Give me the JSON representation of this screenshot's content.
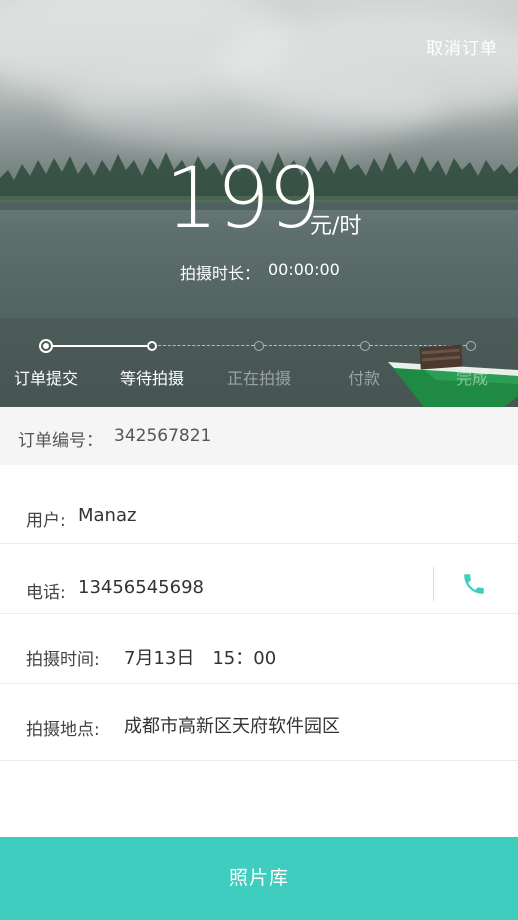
{
  "header": {
    "cancel_label": "取消订单",
    "price": "199",
    "price_unit": "元/时",
    "duration_label": "拍摄时长：",
    "duration_value": "00:00:00"
  },
  "steps": [
    {
      "label": "订单提交",
      "state": "done"
    },
    {
      "label": "等待拍摄",
      "state": "current"
    },
    {
      "label": "正在拍摄",
      "state": "pending"
    },
    {
      "label": "付款",
      "state": "pending"
    },
    {
      "label": "完成",
      "state": "pending"
    }
  ],
  "order": {
    "number_label": "订单编号：",
    "number_value": "342567821"
  },
  "details": {
    "user_label": "用户:",
    "user_value": "Manaz",
    "phone_label": "电话:",
    "phone_value": "13456545698",
    "time_label": "拍摄时间:",
    "time_value": "7月13日　15：00",
    "place_label": "拍摄地点:",
    "place_value": "成都市高新区天府软件园区"
  },
  "footer": {
    "gallery_label": "照片库"
  },
  "colors": {
    "accent": "#3ecdbe",
    "hero_dark": "#4f605e",
    "order_bg": "#f5f5f5"
  },
  "icons": {
    "phone": "phone-icon"
  }
}
